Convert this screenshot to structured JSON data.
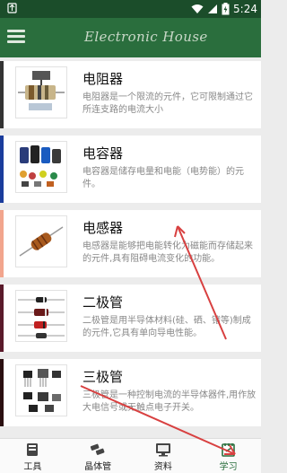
{
  "status_bar": {
    "time": "5:24",
    "left_icon": "notification-icon",
    "wifi_icon": "wifi-icon",
    "signal_icon": "signal-icon",
    "battery_icon": "battery-icon"
  },
  "app_bar": {
    "title": "Electronic House",
    "menu_icon": "menu-icon"
  },
  "items": [
    {
      "title": "电阻器",
      "desc": "电阻器是一个限流的元件，它可限制通过它所连支路的电流大小",
      "accent": "#333333"
    },
    {
      "title": "电容器",
      "desc": "电容器是储存电量和电能（电势能）的元件。",
      "accent": "#1a3c9c"
    },
    {
      "title": "电感器",
      "desc": "电感器是能够把电能转化为磁能而存储起来的元件,具有阻碍电流变化的功能。",
      "accent": "#f2a58d"
    },
    {
      "title": "二极管",
      "desc": "二极管是用半导体材料(硅、硒、锗等)制成的元件,它具有单向导电性能。",
      "accent": "#5a1a2a"
    },
    {
      "title": "三极管",
      "desc": "三极管是一种控制电流的半导体器件,用作放大电信号或无触点电子开关。",
      "accent": "#2a0f10"
    }
  ],
  "tabs": [
    {
      "label": "工具",
      "icon": "toolbox-icon"
    },
    {
      "label": "晶体管",
      "icon": "transistor-icon"
    },
    {
      "label": "资料",
      "icon": "monitor-icon"
    },
    {
      "label": "学习",
      "icon": "notepad-icon"
    }
  ],
  "colors": {
    "primary": "#2a6e3d",
    "status_bar": "#1b4d2a",
    "annotation_arrow": "#d84040"
  }
}
